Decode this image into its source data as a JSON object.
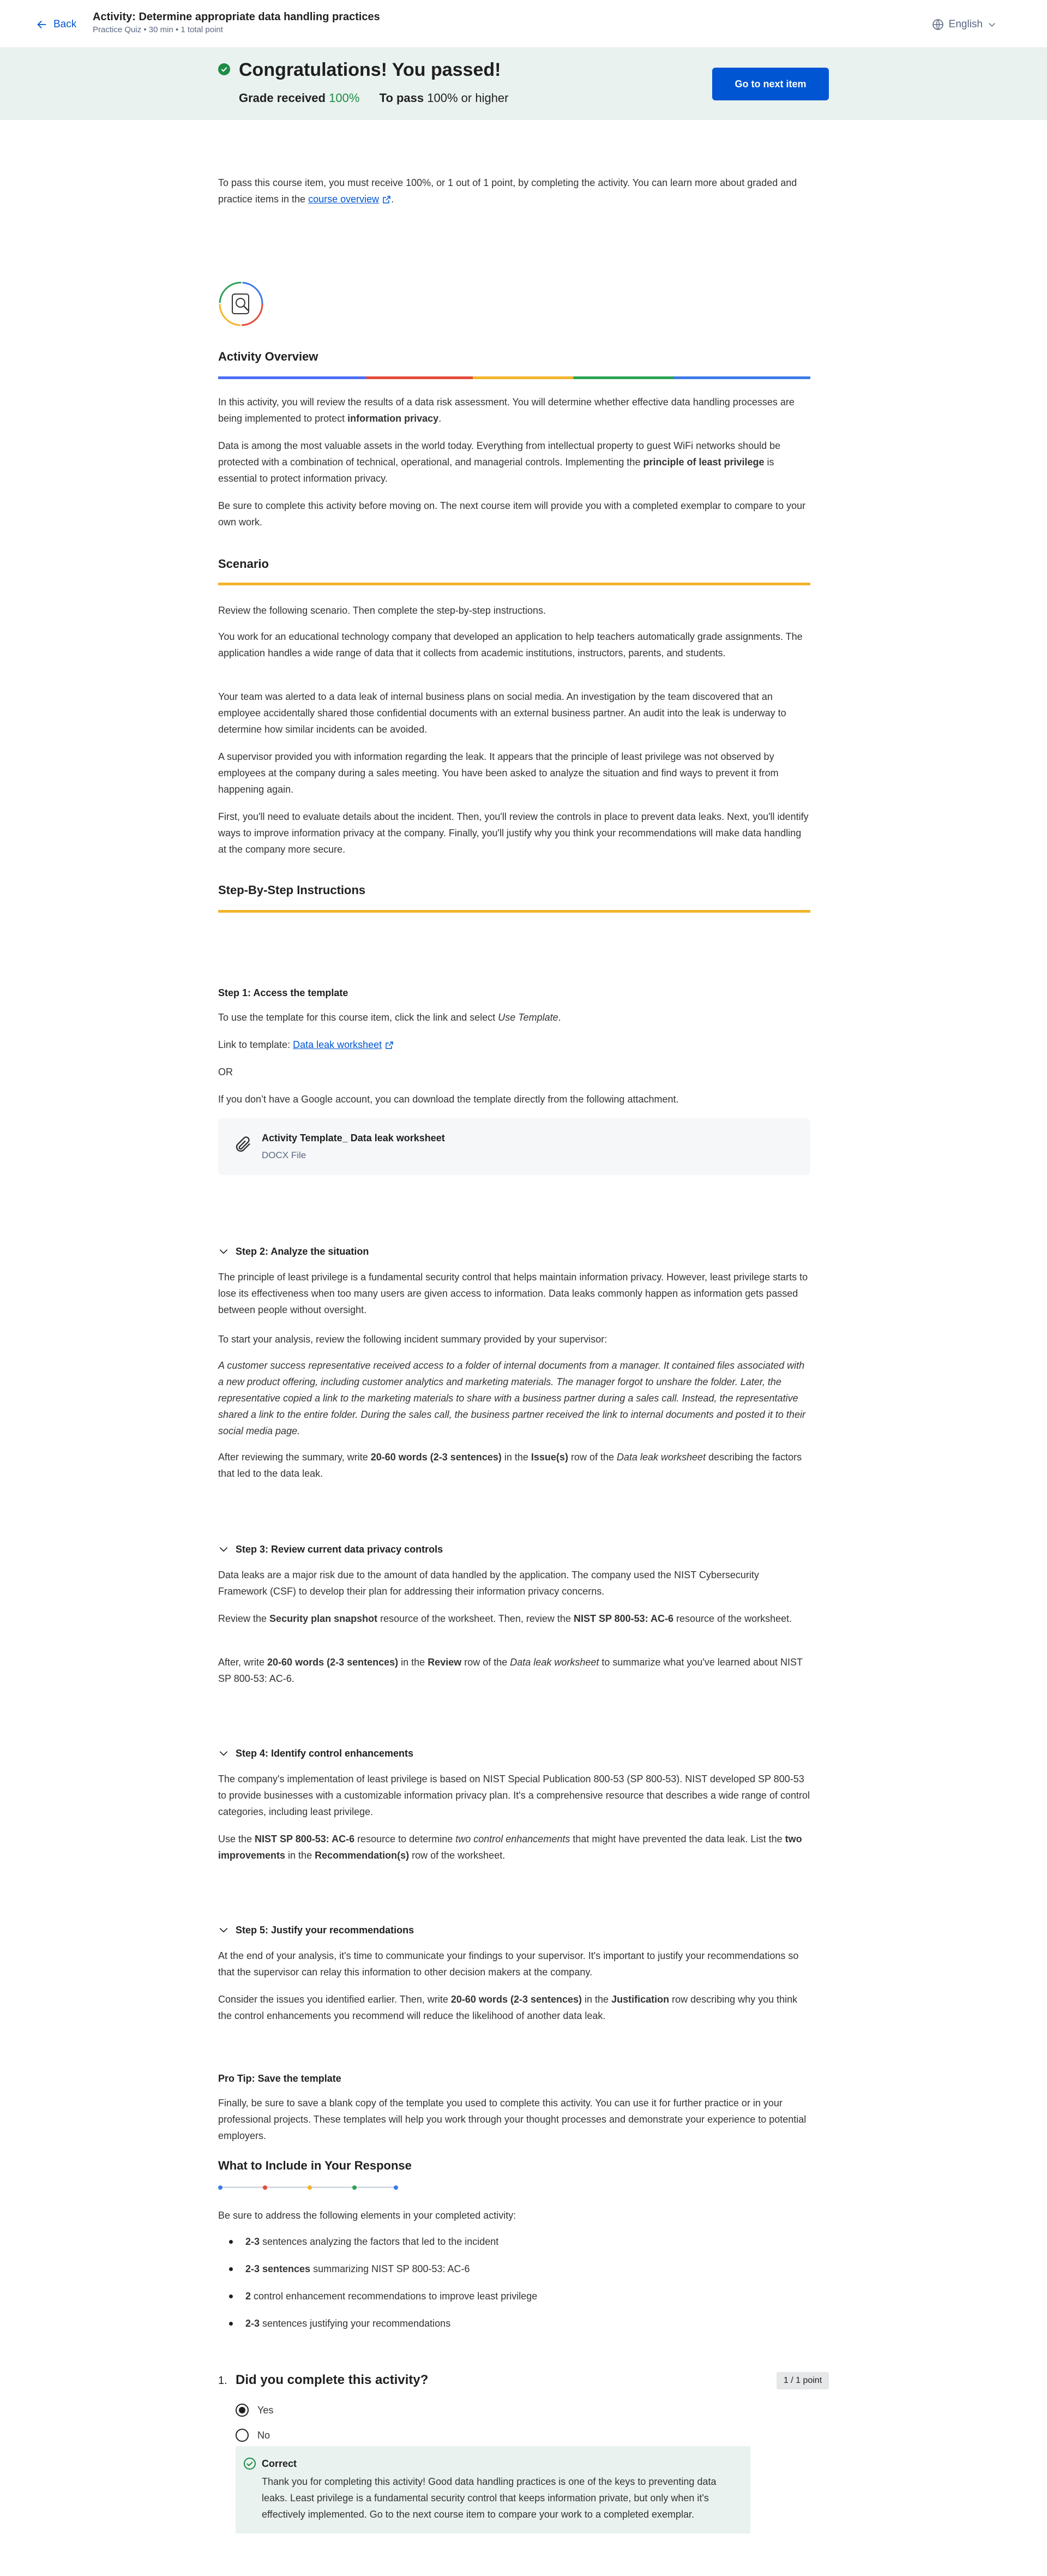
{
  "header": {
    "back_label": "Back",
    "title": "Activity: Determine appropriate data handling practices",
    "subtitle": "Practice Quiz • 30 min • 1 total point",
    "language": "English"
  },
  "banner": {
    "title": "Congratulations! You passed!",
    "grade_label": "Grade received",
    "grade_value": "100%",
    "pass_label": "To pass",
    "pass_value": "100% or higher",
    "next_button": "Go to next item"
  },
  "intro": {
    "text_before": "To pass this course item, you must receive 100%, or 1 out of 1 point, by completing the activity. You can learn more about graded and practice items in the ",
    "link": "course overview",
    "text_after": "."
  },
  "overview": {
    "heading": "Activity Overview",
    "p1_before": "In this activity, you will review the results of a data risk assessment. You will determine whether effective data handling processes are being implemented to protect ",
    "p1_bold": "information privacy",
    "p1_after": ".",
    "p2_before": "Data is among the most valuable assets in the world today. Everything from intellectual property to guest WiFi networks should be protected with a combination of technical, operational, and managerial controls. Implementing the ",
    "p2_bold": "principle of least privilege",
    "p2_after": " is essential to protect information privacy.",
    "p3": "Be sure to complete this activity before moving on. The next course item will provide you with a completed exemplar to compare to your own work."
  },
  "scenario": {
    "heading": "Scenario",
    "p1": "Review the following scenario. Then complete the step-by-step instructions.",
    "p2": "You work for an educational technology company that developed an application to help teachers automatically grade assignments. The application handles a wide range of data that it collects from academic institutions, instructors, parents, and students.",
    "p3": "Your team was alerted to a data leak of internal business plans on social media. An investigation by the team discovered that an employee accidentally shared those confidential documents with an external business partner. An audit into the leak is underway to determine how similar incidents can be avoided.",
    "p4": "A supervisor provided you with information regarding the leak. It appears that the principle of least privilege was not observed by employees at the company during a sales meeting. You have been asked to analyze the situation and find ways to prevent it from happening again.",
    "p5": "First, you'll need to evaluate details about the incident. Then, you'll review the controls in place to prevent data leaks. Next, you'll identify ways to improve information privacy at the company. Finally, you'll justify why you think your recommendations will make data handling at the company more secure."
  },
  "instructions": {
    "heading": "Step-By-Step Instructions"
  },
  "step1": {
    "title": "Step 1: Access the template",
    "p1_before": "To use the template for this course item, click the link and select ",
    "p1_italic": "Use Template",
    "p1_after": ".",
    "link_label": "Link to template: ",
    "link": "Data leak worksheet",
    "or": "OR",
    "p2": "If you don’t have a Google account, you can download the template directly from the following attachment.",
    "attachment_name": "Activity Template_ Data leak worksheet",
    "attachment_type": "DOCX File"
  },
  "step2": {
    "title": "Step 2: Analyze the situation",
    "p1": "The principle of least privilege is a fundamental security control that helps maintain information privacy. However, least privilege starts to lose its effectiveness when too many users are given access to information. Data leaks commonly happen as information gets passed between people without oversight.",
    "p2": "To start your analysis, review the following incident summary provided by your supervisor:",
    "quote": "A customer success representative received access to a folder of internal documents from a manager. It contained files associated with a new product offering, including customer analytics and marketing materials. The manager forgot to unshare the folder. Later, the representative copied a link to the marketing materials to share with a business partner during a sales call. Instead, the representative shared a link to the entire folder. During the sales call, the business partner received the link to internal documents and posted it to their social media page.",
    "p3_a": "After reviewing the summary, write ",
    "p3_b": "20-60 words (2-3 sentences)",
    "p3_c": " in the ",
    "p3_d": "Issue(s)",
    "p3_e": " row of the ",
    "p3_f": "Data leak worksheet",
    "p3_g": " describing the factors that led to the data leak."
  },
  "step3": {
    "title": "Step 3: Review current data privacy controls",
    "p1": "Data leaks are a major risk due to the amount of data handled by the application. The company used the NIST Cybersecurity Framework (CSF) to develop their plan for addressing their information privacy concerns.",
    "p2_a": "Review the ",
    "p2_b": "Security plan snapshot",
    "p2_c": " resource of the worksheet. Then, review the ",
    "p2_d": "NIST SP 800-53: AC-6",
    "p2_e": " resource of the worksheet.",
    "p3_a": "After, write ",
    "p3_b": "20-60 words (2-3 sentences)",
    "p3_c": " in the ",
    "p3_d": "Review",
    "p3_e": " row of the ",
    "p3_f": "Data leak worksheet",
    "p3_g": " to summarize what you've learned about NIST SP 800-53: AC-6."
  },
  "step4": {
    "title": "Step 4: Identify control enhancements",
    "p1": "The company's implementation of least privilege is based on NIST Special Publication 800-53 (SP 800-53). NIST developed SP 800-53 to provide businesses with a customizable information privacy plan. It's a comprehensive resource that describes a wide range of control categories, including least privilege.",
    "p2_a": "Use the ",
    "p2_b": "NIST SP 800-53: AC-6",
    "p2_c": " resource to determine ",
    "p2_d": "two control enhancements",
    "p2_e": " that might have prevented the data leak. List the ",
    "p2_f": "two improvements",
    "p2_g": " in the ",
    "p2_h": "Recommendation(s)",
    "p2_i": " row of the worksheet."
  },
  "step5": {
    "title": "Step 5: Justify your recommendations",
    "p1": "At the end of your analysis, it's time to communicate your findings to your supervisor. It's important to justify your recommendations so that the supervisor can relay this information to other decision makers at the company.",
    "p2_a": "Consider the issues you identified earlier. Then, write ",
    "p2_b": "20-60 words (2-3 sentences)",
    "p2_c": " in the ",
    "p2_d": "Justification",
    "p2_e": " row describing why you think the control enhancements you recommend will reduce the likelihood of another data leak."
  },
  "protip": {
    "title": "Pro Tip: Save the template",
    "p1": "Finally, be sure to save a blank copy of the template you used to complete this activity. You can use it for further practice or in your professional projects. These templates will help you work through your thought processes and demonstrate your experience to potential employers."
  },
  "include": {
    "heading": "What to Include in Your Response",
    "intro": "Be sure to address the following elements in your completed activity:",
    "items": [
      {
        "bold": "2-3",
        "rest": " sentences analyzing the factors that led to the incident"
      },
      {
        "bold": "2-3 sentences",
        "rest": " summarizing NIST SP 800-53: AC-6"
      },
      {
        "bold": "2",
        "rest": " control enhancement recommendations to improve least privilege"
      },
      {
        "bold": "2-3",
        "rest": " sentences justifying your recommendations"
      }
    ]
  },
  "quiz": {
    "number": "1.",
    "question": "Did you complete this activity?",
    "points": "1 / 1 point",
    "options": [
      "Yes",
      "No"
    ],
    "selected": "Yes",
    "feedback_title": "Correct",
    "feedback_text": "Thank you for completing this activity! Good data handling practices is one of the keys to preventing data leaks. Least privilege is a fundamental security control that keeps information private, but only when it's effectively implemented. Go to the next course item to compare your work to a completed exemplar."
  },
  "colors": {
    "accent": "#0056d2",
    "success": "#1e8c45",
    "banner_bg": "#e9f2ef",
    "rule_yellow": "#f3b42b"
  }
}
